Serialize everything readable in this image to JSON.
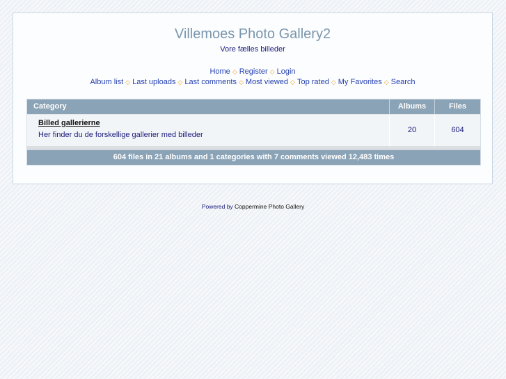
{
  "header": {
    "title": "Villemoes Photo Gallery2",
    "subtitle": "Vore fælles billeder"
  },
  "nav": {
    "primary": [
      {
        "label": "Home"
      },
      {
        "label": "Register"
      },
      {
        "label": "Login"
      }
    ],
    "secondary": [
      {
        "label": "Album list"
      },
      {
        "label": "Last uploads"
      },
      {
        "label": "Last comments"
      },
      {
        "label": "Most viewed"
      },
      {
        "label": "Top rated"
      },
      {
        "label": "My Favorites"
      },
      {
        "label": "Search"
      }
    ],
    "separator_icon": "diamond-outline-icon",
    "separator_color": "#e8a028"
  },
  "table": {
    "columns": [
      "Category",
      "Albums",
      "Files"
    ],
    "rows": [
      {
        "name": "Billed gallerierne",
        "description": "Her finder du de forskellige gallerier med billeder",
        "albums": "20",
        "files": "604"
      }
    ],
    "stats": "604 files in 21 albums and 1 categories with 7 comments viewed 12,483 times"
  },
  "footer": {
    "powered_by": "Powered by",
    "link": "Coppermine Photo Gallery"
  },
  "colors": {
    "header_bar": "#8ba3b6",
    "title": "#7a96ad",
    "link": "#2540b0"
  }
}
